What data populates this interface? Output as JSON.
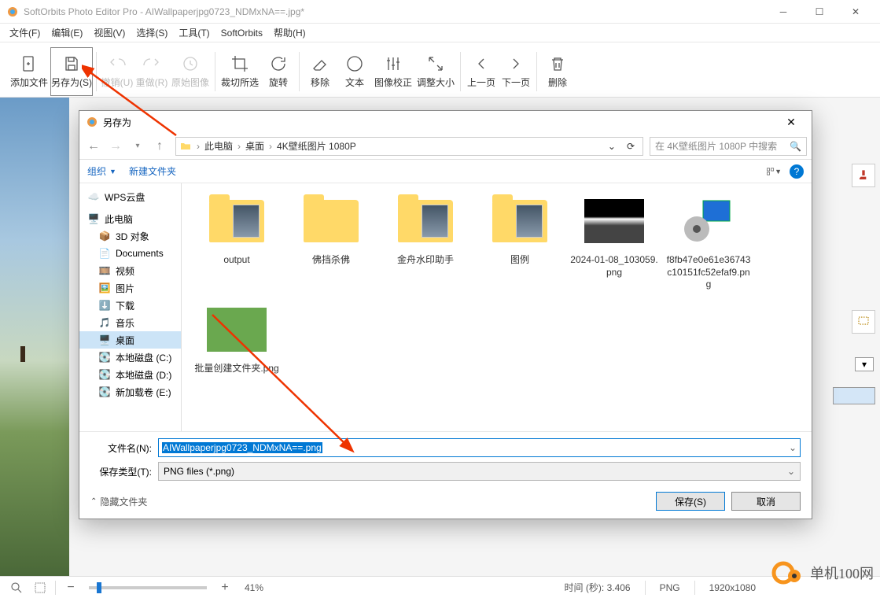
{
  "window": {
    "title": "SoftOrbits Photo Editor Pro - AIWallpaperjpg0723_NDMxNA==.jpg*"
  },
  "menu": {
    "file": "文件(F)",
    "edit": "编辑(E)",
    "view": "视图(V)",
    "select": "选择(S)",
    "tools": "工具(T)",
    "softorbits": "SoftOrbits",
    "help": "帮助(H)"
  },
  "toolbar": {
    "add_file": "添加文件",
    "save_as": "另存为(S)",
    "undo": "撤销(U)",
    "redo": "重做(R)",
    "original": "原始图像",
    "crop": "裁切所选",
    "rotate": "旋转",
    "remove": "移除",
    "text": "文本",
    "correction": "图像校正",
    "resize": "调整大小",
    "prev": "上一页",
    "next": "下一页",
    "delete": "删除"
  },
  "dialog": {
    "title": "另存为",
    "path": {
      "root": "此电脑",
      "folder1": "桌面",
      "folder2": "4K壁纸图片 1080P"
    },
    "search_placeholder": "在 4K壁纸图片 1080P 中搜索",
    "organize": "组织",
    "new_folder": "新建文件夹",
    "tree": {
      "wps": "WPS云盘",
      "thispc": "此电脑",
      "objects3d": "3D 对象",
      "documents": "Documents",
      "videos": "视频",
      "pictures": "图片",
      "downloads": "下载",
      "music": "音乐",
      "desktop": "桌面",
      "diskc": "本地磁盘 (C:)",
      "diskd": "本地磁盘 (D:)",
      "diske": "新加载卷 (E:)"
    },
    "files": [
      {
        "name": "output",
        "type": "folder-preview"
      },
      {
        "name": "佛挡杀佛",
        "type": "folder"
      },
      {
        "name": "金舟水印助手",
        "type": "folder-preview"
      },
      {
        "name": "图例",
        "type": "folder-preview"
      },
      {
        "name": "2024-01-08_103059.png",
        "type": "image-dark"
      },
      {
        "name": "f8fb47e0e61e36743c10151fc52efaf9.png",
        "type": "image-icon"
      },
      {
        "name": "批量创建文件夹.png",
        "type": "image-gray"
      }
    ],
    "filename_label": "文件名(N):",
    "filename_value": "AIWallpaperjpg0723_NDMxNA==.png",
    "type_label": "保存类型(T):",
    "type_value": "PNG files (*.png)",
    "hide_folders": "隐藏文件夹",
    "save_btn": "保存(S)",
    "cancel_btn": "取消"
  },
  "status": {
    "zoom": "41%",
    "time_label": "时间 (秒):",
    "time_value": "3.406",
    "format": "PNG",
    "dimensions": "1920x1080"
  },
  "badge": {
    "text": "单机100网"
  }
}
